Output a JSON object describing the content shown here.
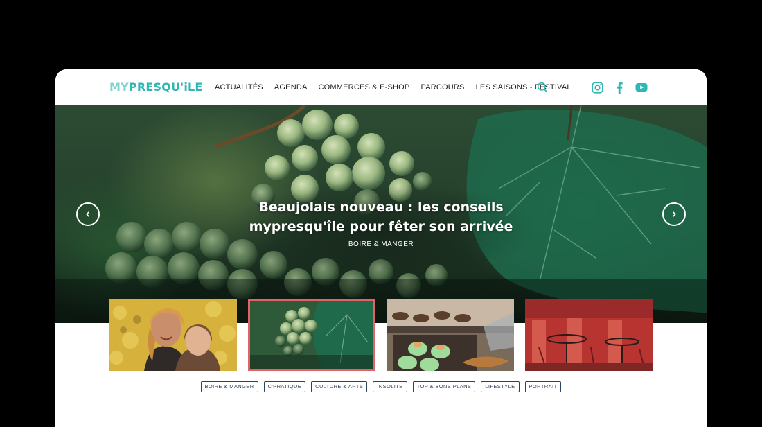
{
  "site": {
    "logo_part1": "MY",
    "logo_part2": "PRESQU'iLE",
    "brand_color": "#2fb7b3"
  },
  "nav": {
    "items": [
      {
        "label": "ACTUALITÉS"
      },
      {
        "label": "AGENDA"
      },
      {
        "label": "COMMERCES & E-SHOP"
      },
      {
        "label": "PARCOURS"
      },
      {
        "label": "LES SAISONS - FESTIVAL"
      }
    ],
    "search_icon": "search-icon"
  },
  "social": [
    {
      "icon": "instagram-icon"
    },
    {
      "icon": "facebook-icon"
    },
    {
      "icon": "youtube-icon"
    }
  ],
  "hero": {
    "title_line1": "Beaujolais nouveau : les conseils",
    "title_line2": "mypresqu'île pour fêter son arrivée",
    "category": "BOIRE & MANGER",
    "prev_icon": "chevron-left-icon",
    "next_icon": "chevron-right-icon"
  },
  "thumbnails": [
    {
      "subject": "women-smiling-autumn",
      "active": false
    },
    {
      "subject": "grapes-vine",
      "active": true
    },
    {
      "subject": "pastries-display",
      "active": false
    },
    {
      "subject": "red-terrace-cafe",
      "active": false
    }
  ],
  "active_accent": "#e06366",
  "tags": [
    {
      "label": "BOIRE & MANGER"
    },
    {
      "label": "C'PRATIQUE"
    },
    {
      "label": "CULTURE & ARTS"
    },
    {
      "label": "INSOLITE"
    },
    {
      "label": "TOP & BONS PLANS"
    },
    {
      "label": "LIFESTYLE"
    },
    {
      "label": "PORTRAIT"
    }
  ]
}
